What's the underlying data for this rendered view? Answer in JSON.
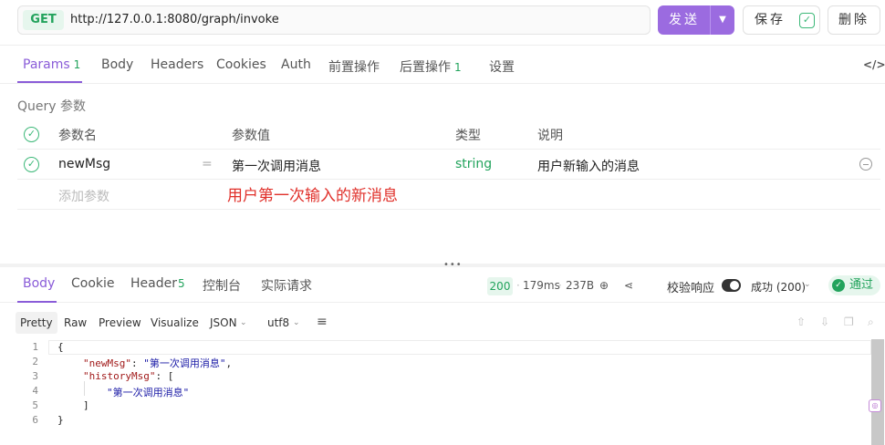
{
  "request": {
    "method": "GET",
    "url": "http://127.0.0.1:8080/graph/invoke",
    "send_label": "发送",
    "save_label": "保存",
    "delete_label": "删除"
  },
  "request_tabs": [
    {
      "label": "Params",
      "badge": "1"
    },
    {
      "label": "Body",
      "badge": ""
    },
    {
      "label": "Headers",
      "badge": ""
    },
    {
      "label": "Cookies",
      "badge": ""
    },
    {
      "label": "Auth",
      "badge": ""
    },
    {
      "label": "前置操作",
      "badge": ""
    },
    {
      "label": "后置操作",
      "badge": "1"
    },
    {
      "label": "设置",
      "badge": ""
    }
  ],
  "query": {
    "title": "Query 参数",
    "headers": {
      "name": "参数名",
      "value": "参数值",
      "type": "类型",
      "desc": "说明"
    },
    "rows": [
      {
        "name": "newMsg",
        "eq": "=",
        "value": "第一次调用消息",
        "type": "string",
        "desc": "用户新输入的消息"
      }
    ],
    "add_placeholder": "添加参数",
    "annotation": "用户第一次输入的新消息"
  },
  "response_tabs": [
    {
      "label": "Body",
      "badge": ""
    },
    {
      "label": "Cookie",
      "badge": ""
    },
    {
      "label": "Header",
      "badge": "5"
    },
    {
      "label": "控制台",
      "badge": ""
    },
    {
      "label": "实际请求",
      "badge": ""
    }
  ],
  "response_meta": {
    "status": "200",
    "time": "179ms",
    "size": "237B",
    "validate_label": "校验响应",
    "result": "成功 (200)",
    "pass_label": "通过"
  },
  "format_bar": {
    "modes": [
      "Pretty",
      "Raw",
      "Preview",
      "Visualize"
    ],
    "format": "JSON",
    "encoding": "utf8"
  },
  "code_lines": [
    {
      "n": "1",
      "text": "{"
    },
    {
      "n": "2",
      "key": "\"newMsg\"",
      "sep": ": ",
      "val": "\"第一次调用消息\"",
      "tail": ","
    },
    {
      "n": "3",
      "key": "\"historyMsg\"",
      "sep": ": ",
      "val": "",
      "tail": "["
    },
    {
      "n": "4",
      "text": "",
      "val": "\"第一次调用消息\""
    },
    {
      "n": "5",
      "text": "]"
    },
    {
      "n": "6",
      "text": "}"
    }
  ],
  "icons": [
    "code-brackets-icon",
    "globe-icon",
    "share-icon",
    "chevron-down-icon",
    "check-icon",
    "minus-circle-icon",
    "wrap-lines-icon",
    "upload-icon",
    "download-icon",
    "copy-icon",
    "search-icon"
  ]
}
